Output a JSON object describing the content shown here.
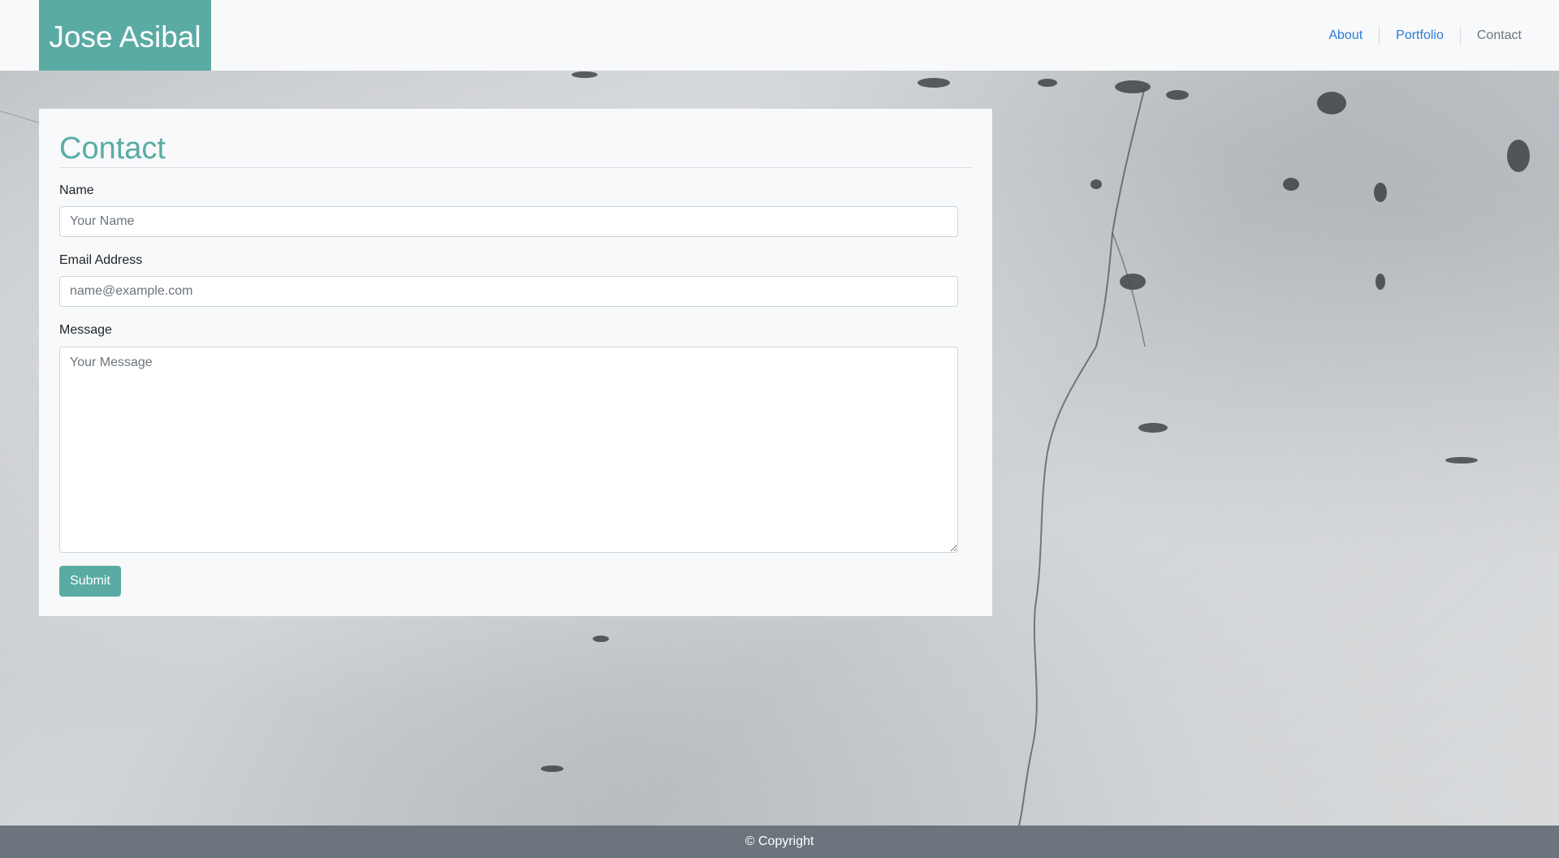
{
  "brand": "Jose Asibal",
  "nav": {
    "items": [
      {
        "label": "About",
        "active": false
      },
      {
        "label": "Portfolio",
        "active": false
      },
      {
        "label": "Contact",
        "active": true
      }
    ]
  },
  "contact": {
    "title": "Contact",
    "name_label": "Name",
    "name_placeholder": "Your Name",
    "email_label": "Email Address",
    "email_placeholder": "name@example.com",
    "message_label": "Message",
    "message_placeholder": "Your Message",
    "submit_label": "Submit"
  },
  "footer": {
    "text": "© Copyright"
  },
  "colors": {
    "accent": "#5aaba3",
    "link": "#2a7ad8",
    "muted": "#6c757d",
    "navbar_bg": "#f8f9fa",
    "footer_bg": "#6c757d"
  }
}
